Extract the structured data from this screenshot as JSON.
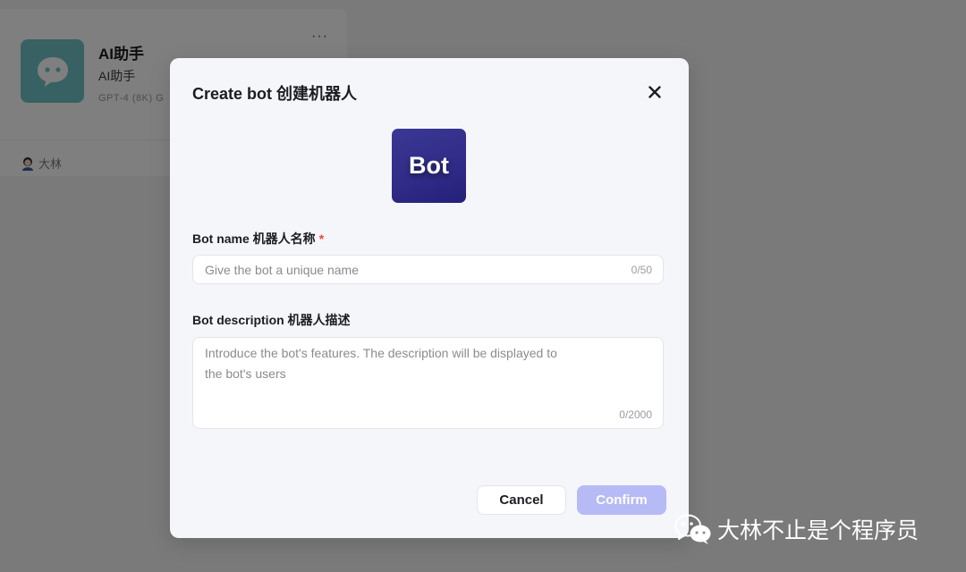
{
  "background_card": {
    "title": "AI助手",
    "subtitle": "AI助手",
    "model": "GPT-4 (8K) G",
    "more": "···",
    "user_name": "大林"
  },
  "modal": {
    "title": "Create bot 创建机器人",
    "logo_text": "Bot",
    "name_field": {
      "label": "Bot name 机器人名称",
      "required_mark": "*",
      "placeholder": "Give the bot a unique name",
      "counter": "0/50"
    },
    "description_field": {
      "label": "Bot description 机器人描述",
      "placeholder_line1": "Introduce the bot's features. The description will be displayed to",
      "placeholder_line2": "the bot's users",
      "counter": "0/2000"
    },
    "buttons": {
      "cancel": "Cancel",
      "confirm": "Confirm"
    }
  },
  "watermark": {
    "text": "大林不止是个程序员",
    "icon": "wechat-icon"
  },
  "colors": {
    "overlay": "rgba(0,0,0,0.5)",
    "logo_bg": "#2f2b86",
    "confirm_disabled": "#b6baf5",
    "required": "#f04438"
  }
}
